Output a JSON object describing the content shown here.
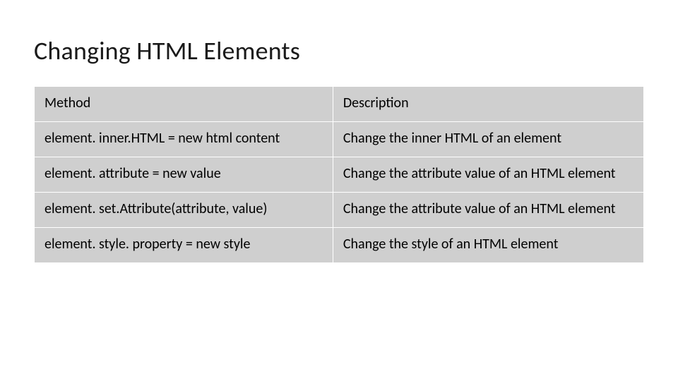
{
  "slide": {
    "title": "Changing HTML Elements"
  },
  "table": {
    "headers": {
      "method": "Method",
      "description": "Description"
    },
    "rows": [
      {
        "method": "element. inner.HTML =  new html content",
        "description": "Change the inner HTML of an element"
      },
      {
        "method": "element. attribute = new value",
        "description": "Change the attribute value of an HTML element"
      },
      {
        "method": "element. set.Attribute(attribute, value)",
        "description": "Change the attribute value of an HTML element"
      },
      {
        "method": "element. style. property = new style",
        "description": "Change the style of an HTML element"
      }
    ]
  }
}
